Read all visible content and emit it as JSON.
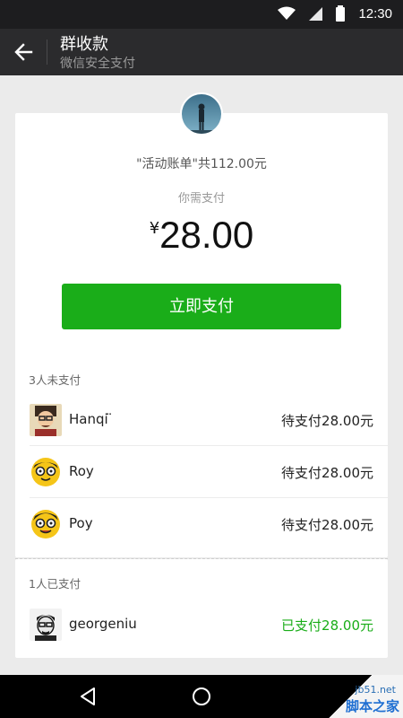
{
  "statusbar": {
    "time": "12:30",
    "icons": [
      "wifi-icon",
      "signal-icon",
      "battery-icon"
    ]
  },
  "navbar": {
    "back_icon": "arrow-left-icon",
    "title": "群收款",
    "subtitle": "微信安全支付"
  },
  "bill": {
    "title": "\"活动账单\"共112.00元",
    "need_pay_label": "你需支付",
    "currency": "¥",
    "amount": "28.00",
    "pay_button": "立即支付"
  },
  "unpaid": {
    "label": "3人未支付",
    "items": [
      {
        "name": "Hanqi ̈",
        "status": "待支付28.00元"
      },
      {
        "name": "Roy",
        "status": "待支付28.00元"
      },
      {
        "name": "Poy",
        "status": "待支付28.00元"
      }
    ]
  },
  "paid": {
    "label": "1人已支付",
    "items": [
      {
        "name": "georgeniu",
        "status": "已支付28.00元"
      }
    ]
  },
  "colors": {
    "accent": "#1aad19",
    "header": "#2b2b2d",
    "statusbar": "#1d1d1f"
  },
  "watermark": {
    "line1": "jb51.net",
    "line2": "脚本之家"
  }
}
